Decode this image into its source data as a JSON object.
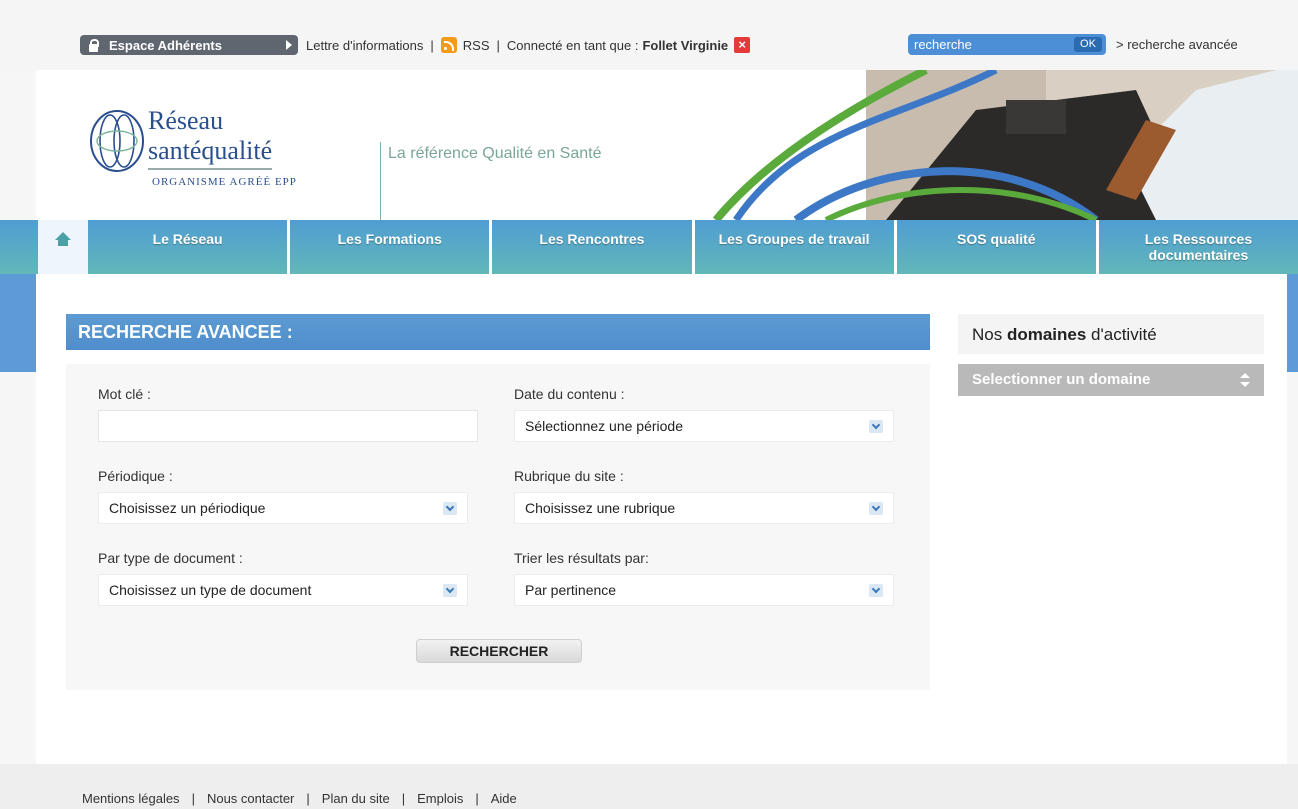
{
  "topbar": {
    "espace_label": "Espace Adhérents",
    "links": [
      "Lettre d'informations",
      "RSS",
      "Connecté en tant que :"
    ],
    "user_name": "Follet Virginie",
    "search": {
      "placeholder": "recherche",
      "ok_label": "OK"
    },
    "advanced_link": "> recherche avancée"
  },
  "header": {
    "logo": {
      "line1": "Réseau",
      "line2": "santéqualité",
      "line3": "ORGANISME AGRÉÉ EPP"
    },
    "tagline": "La référence Qualité en Santé"
  },
  "nav": {
    "items": [
      "Le Réseau",
      "Les Formations",
      "Les Rencontres",
      "Les Groupes de travail",
      "SOS qualité",
      "Les Ressources documentaires"
    ]
  },
  "search_form": {
    "title": "RECHERCHE AVANCEE :",
    "keyword_label": "Mot clé :",
    "keyword_value": "",
    "date_label": "Date du contenu :",
    "date_value": "Sélectionnez une période",
    "periodique_label": "Périodique :",
    "periodique_value": "Choisissez un périodique",
    "rubrique_label": "Rubrique du site :",
    "rubrique_value": "Choisissez une rubrique",
    "doctype_label": "Par type de document :",
    "doctype_value": "Choisissez un type de document",
    "sort_label": "Trier les résultats par:",
    "sort_value": "Par pertinence",
    "submit_label": "RECHERCHER"
  },
  "sidebar": {
    "title_prefix": "Nos ",
    "title_bold": "domaines",
    "title_suffix": " d'activité",
    "domain_select": "Selectionner un domaine"
  },
  "footer": {
    "links": [
      "Mentions légales",
      "Nous contacter",
      "Plan du site",
      "Emplois",
      "Aide"
    ]
  },
  "colors": {
    "nav_blue": "#4f9dd3",
    "nav_teal": "#62b7b8",
    "title_blue": "#5c9bd2",
    "logo_blue": "#2a4f8f",
    "close_red": "#e33a3a",
    "rss_orange": "#f39a1b"
  }
}
